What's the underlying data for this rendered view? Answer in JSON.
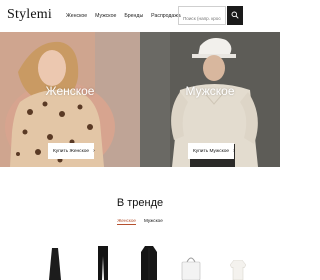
{
  "header": {
    "logo": "Stylemi",
    "nav": [
      "Женское",
      "Мужское",
      "Бренды",
      "Распродажа"
    ],
    "search": {
      "placeholder": "Поиск (напр. кроссовки)"
    }
  },
  "hero": {
    "left": {
      "title": "Женское",
      "button_label": "Купить Женское",
      "button_arrow": "›"
    },
    "right": {
      "title": "Мужское",
      "button_label": "Купить Мужское",
      "button_arrow": "›"
    }
  },
  "trending": {
    "title": "В тренде",
    "tabs": [
      "Женское",
      "Мужское"
    ],
    "active_tab": "Женское",
    "accent_color": "#b5512f"
  },
  "products": [
    {
      "icon": "dress-icon"
    },
    {
      "icon": "pants-icon"
    },
    {
      "icon": "coat-icon"
    },
    {
      "icon": "handbag-icon"
    },
    {
      "icon": "sweater-icon"
    }
  ]
}
